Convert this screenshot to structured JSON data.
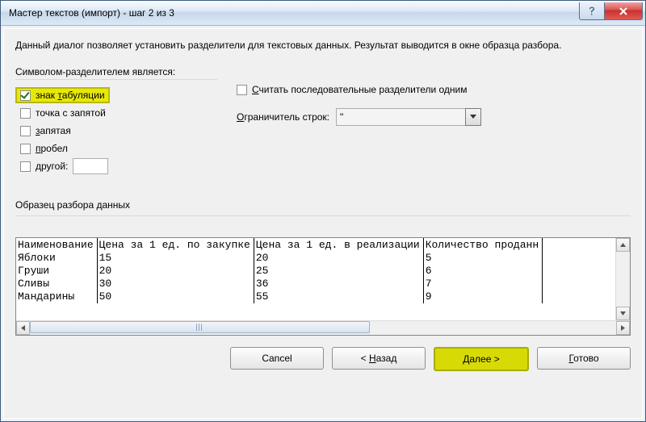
{
  "window": {
    "title": "Мастер текстов (импорт) - шаг 2 из 3"
  },
  "description": "Данный диалог позволяет установить разделители для текстовых данных. Результат выводится в окне образца разбора.",
  "delimiters": {
    "legend": "Символом-разделителем является:",
    "tab": {
      "label": "знак табуляции",
      "accel": "т",
      "checked": true
    },
    "semicolon": {
      "label": "точка с запятой",
      "checked": false
    },
    "comma": {
      "label": "запятая",
      "accel": "з",
      "checked": false
    },
    "space": {
      "label": "пробел",
      "accel": "п",
      "checked": false
    },
    "other": {
      "label": "другой:",
      "accel": "д",
      "checked": false,
      "value": ""
    }
  },
  "consecutive": {
    "label": "Считать последовательные разделители одним",
    "accel": "С",
    "checked": false
  },
  "qualifier": {
    "label": "Ограничитель строк:",
    "accel": "О",
    "value": "\""
  },
  "preview": {
    "legend": "Образец разбора данных",
    "headers": [
      "Наименование",
      "Цена за 1 ед. по закупке",
      "Цена за 1 ед. в реализации",
      "Количество проданн"
    ],
    "rows": [
      [
        "Яблоки",
        "15",
        "20",
        "5"
      ],
      [
        "Груши",
        "20",
        "25",
        "6"
      ],
      [
        "Сливы",
        "30",
        "36",
        "7"
      ],
      [
        "Мандарины",
        "50",
        "55",
        "9"
      ]
    ]
  },
  "buttons": {
    "cancel": "Cancel",
    "back": {
      "text": "< Назад",
      "accel": "Н"
    },
    "next": {
      "text": "Далее >",
      "accel": "Д"
    },
    "finish": {
      "text": "Готово",
      "accel": "Г"
    }
  }
}
